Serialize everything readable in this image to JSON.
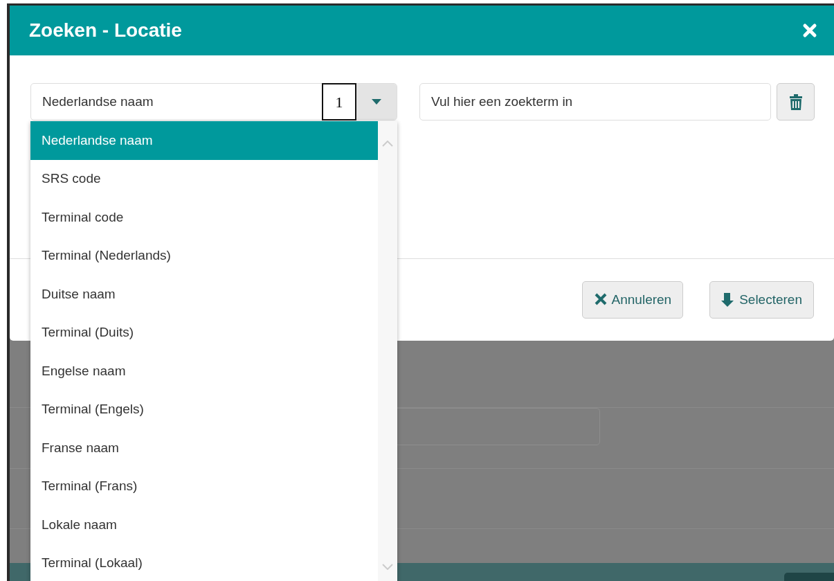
{
  "dialog": {
    "title": "Zoeken - Locatie"
  },
  "field_select": {
    "value": "Nederlandse naam",
    "badge": "1",
    "expanded": true,
    "options": [
      {
        "label": "Nederlandse naam",
        "selected": true
      },
      {
        "label": "SRS code",
        "selected": false
      },
      {
        "label": "Terminal code",
        "selected": false
      },
      {
        "label": "Terminal (Nederlands)",
        "selected": false
      },
      {
        "label": "Duitse naam",
        "selected": false
      },
      {
        "label": "Terminal (Duits)",
        "selected": false
      },
      {
        "label": "Engelse naam",
        "selected": false
      },
      {
        "label": "Terminal (Engels)",
        "selected": false
      },
      {
        "label": "Franse naam",
        "selected": false
      },
      {
        "label": "Terminal (Frans)",
        "selected": false
      },
      {
        "label": "Lokale naam",
        "selected": false
      },
      {
        "label": "Terminal (Lokaal)",
        "selected": false
      }
    ]
  },
  "search": {
    "placeholder": "Vul hier een zoekterm in"
  },
  "buttons": [
    {
      "kind": "cancel",
      "label": "Annuleren"
    },
    {
      "kind": "select",
      "label": "Selecteren"
    }
  ]
}
